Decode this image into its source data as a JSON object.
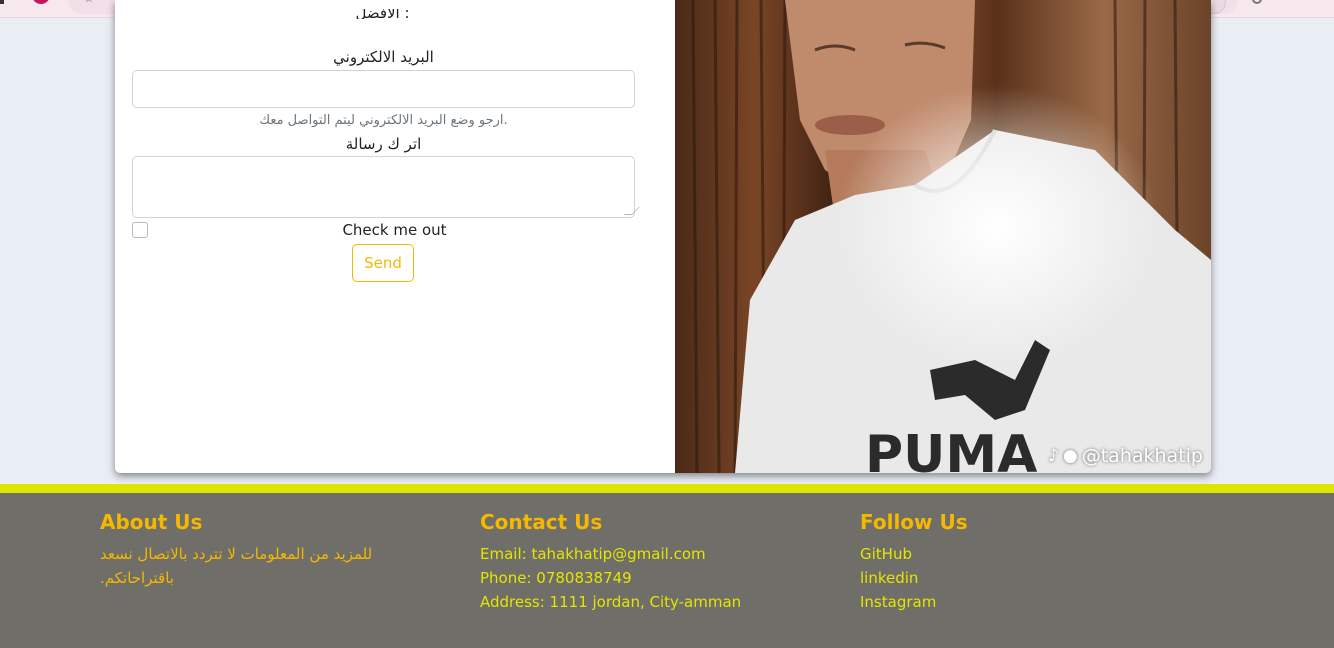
{
  "form": {
    "cut_label": "الافضل :",
    "email_label": "البريد الالكتروني",
    "email_value": "",
    "email_help": "ارجو وضع البريد الالكتروني ليتم التواصل معك.",
    "message_label": "اتر ك رسالة",
    "message_value": "",
    "check_label": "Check me out",
    "send_label": "Send"
  },
  "photo": {
    "watermark": "@tahakhatip"
  },
  "footer": {
    "about": {
      "title": "About Us",
      "text": "للمزيد من المعلومات لا تتردد بالاتصال نسعد باقتراحاتكم."
    },
    "contact": {
      "title": "Contact Us",
      "email": "Email: tahakhatip@gmail.com",
      "phone": "Phone: 0780838749",
      "address": "Address: 1111 jordan, City-amman"
    },
    "follow": {
      "title": "Follow Us",
      "links": [
        "GitHub",
        "linkedin",
        "Instagram"
      ]
    }
  },
  "colors": {
    "accent": "#f5b800",
    "footer_bg": "#6f6e69",
    "footer_border": "#dde600",
    "footer_link": "#e5e500"
  }
}
